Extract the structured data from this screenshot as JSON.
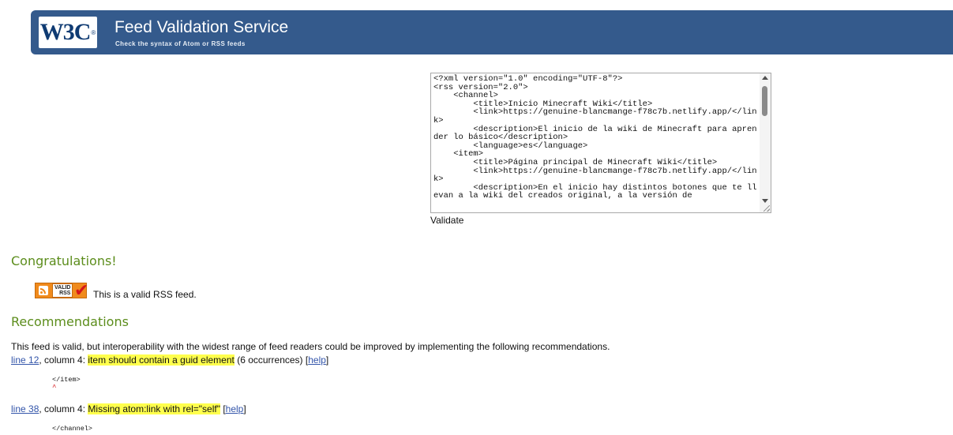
{
  "header": {
    "logo_text": "W3C",
    "logo_reg": "®",
    "title": "Feed Validation Service",
    "subtitle": "Check the syntax of Atom or RSS feeds"
  },
  "source": {
    "content": "<?xml version=\"1.0\" encoding=\"UTF-8\"?>\n<rss version=\"2.0\">\n    <channel>\n        <title>Inicio Minecraft Wiki</title>\n        <link>https://genuine-blancmange-f78c7b.netlify.app/</link>\n        <description>El inicio de la wiki de Minecraft para aprender lo básico</description>\n        <language>es</language>\n    <item>\n        <title>Página principal de Minecraft Wiki</title>\n        <link>https://genuine-blancmange-f78c7b.netlify.app/</link>\n        <description>En el inicio hay distintos botones que te llevan a la wiki del creados original, a la versión de"
  },
  "validate_label": "Validate",
  "congrats": {
    "heading": "Congratulations!",
    "badge_label_top": "VALID",
    "badge_label_bottom": "RSS",
    "message": "This is a valid RSS feed."
  },
  "recommendations": {
    "heading": "Recommendations",
    "intro": "This feed is valid, but interoperability with the widest range of feed readers could be improved by implementing the following recommendations.",
    "items": [
      {
        "line_link": "line 12",
        "column_text": ", column 4: ",
        "message": "item should contain a guid element",
        "extra": " (6 occurrences) [",
        "help": "help",
        "close": "]",
        "snippet": "</item>",
        "caret": "^"
      },
      {
        "line_link": "line 38",
        "column_text": ", column 4: ",
        "message": "Missing atom:link with rel=\"self\"",
        "extra": " [",
        "help": "help",
        "close": "]",
        "snippet": "</channel>"
      }
    ]
  },
  "colors": {
    "header_bg": "#345a8c",
    "heading_green": "#5c8d1c",
    "highlight": "#ffff4d",
    "link": "#3355aa"
  }
}
